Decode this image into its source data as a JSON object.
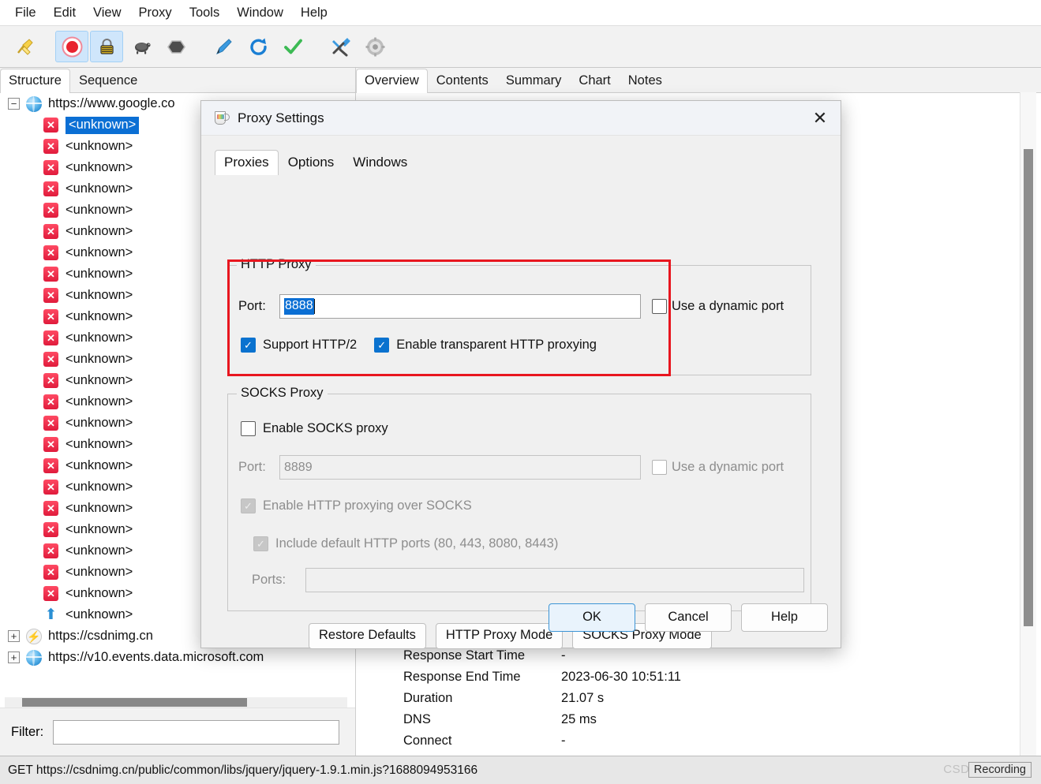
{
  "menubar": {
    "items": [
      "File",
      "Edit",
      "View",
      "Proxy",
      "Tools",
      "Window",
      "Help"
    ]
  },
  "toolbar": {
    "buttons": [
      {
        "name": "clear-session",
        "icon": "broom-icon",
        "glyph": "🧹",
        "active": false
      },
      {
        "name": "start-stop-recording",
        "icon": "record-icon",
        "glyph": "⏺",
        "active": true
      },
      {
        "name": "ssl-proxying",
        "icon": "lock-icon",
        "glyph": "🔒",
        "active": true
      },
      {
        "name": "throttling",
        "icon": "turtle-icon",
        "glyph": "🐢",
        "active": false
      },
      {
        "name": "breakpoints",
        "icon": "hexagon-icon",
        "glyph": "⬢",
        "active": false
      },
      {
        "name": "compose",
        "icon": "pen-icon",
        "glyph": "🖊",
        "active": false
      },
      {
        "name": "repeat",
        "icon": "refresh-icon",
        "glyph": "↻",
        "active": false
      },
      {
        "name": "validate",
        "icon": "checkmark-icon",
        "glyph": "✔",
        "active": false
      },
      {
        "name": "tools",
        "icon": "tools-icon",
        "glyph": "🛠",
        "active": false
      },
      {
        "name": "settings",
        "icon": "gear-icon",
        "glyph": "⚙",
        "active": false
      }
    ]
  },
  "left_tabs": {
    "items": [
      "Structure",
      "Sequence"
    ],
    "selected": "Structure"
  },
  "right_tabs": {
    "items": [
      "Overview",
      "Contents",
      "Summary",
      "Chart",
      "Notes"
    ],
    "selected": "Overview"
  },
  "tree": {
    "rows": [
      {
        "kind": "root",
        "icon": "globe-icon",
        "expander": "minus",
        "label": "https://www.google.co",
        "selected": false
      },
      {
        "kind": "child",
        "icon": "error-icon",
        "label": "<unknown>",
        "selected": true
      },
      {
        "kind": "child",
        "icon": "error-icon",
        "label": "<unknown>",
        "selected": false
      },
      {
        "kind": "child",
        "icon": "error-icon",
        "label": "<unknown>",
        "selected": false
      },
      {
        "kind": "child",
        "icon": "error-icon",
        "label": "<unknown>",
        "selected": false
      },
      {
        "kind": "child",
        "icon": "error-icon",
        "label": "<unknown>",
        "selected": false
      },
      {
        "kind": "child",
        "icon": "error-icon",
        "label": "<unknown>",
        "selected": false
      },
      {
        "kind": "child",
        "icon": "error-icon",
        "label": "<unknown>",
        "selected": false
      },
      {
        "kind": "child",
        "icon": "error-icon",
        "label": "<unknown>",
        "selected": false
      },
      {
        "kind": "child",
        "icon": "error-icon",
        "label": "<unknown>",
        "selected": false
      },
      {
        "kind": "child",
        "icon": "error-icon",
        "label": "<unknown>",
        "selected": false
      },
      {
        "kind": "child",
        "icon": "error-icon",
        "label": "<unknown>",
        "selected": false
      },
      {
        "kind": "child",
        "icon": "error-icon",
        "label": "<unknown>",
        "selected": false
      },
      {
        "kind": "child",
        "icon": "error-icon",
        "label": "<unknown>",
        "selected": false
      },
      {
        "kind": "child",
        "icon": "error-icon",
        "label": "<unknown>",
        "selected": false
      },
      {
        "kind": "child",
        "icon": "error-icon",
        "label": "<unknown>",
        "selected": false
      },
      {
        "kind": "child",
        "icon": "error-icon",
        "label": "<unknown>",
        "selected": false
      },
      {
        "kind": "child",
        "icon": "error-icon",
        "label": "<unknown>",
        "selected": false
      },
      {
        "kind": "child",
        "icon": "error-icon",
        "label": "<unknown>",
        "selected": false
      },
      {
        "kind": "child",
        "icon": "error-icon",
        "label": "<unknown>",
        "selected": false
      },
      {
        "kind": "child",
        "icon": "error-icon",
        "label": "<unknown>",
        "selected": false
      },
      {
        "kind": "child",
        "icon": "error-icon",
        "label": "<unknown>",
        "selected": false
      },
      {
        "kind": "child",
        "icon": "error-icon",
        "label": "<unknown>",
        "selected": false
      },
      {
        "kind": "child",
        "icon": "error-icon",
        "label": "<unknown>",
        "selected": false
      },
      {
        "kind": "child",
        "icon": "upload-icon",
        "label": "<unknown>",
        "selected": false
      },
      {
        "kind": "root",
        "icon": "bolt-icon",
        "expander": "plus",
        "label": "https://csdnimg.cn",
        "selected": false
      },
      {
        "kind": "root",
        "icon": "globe-icon",
        "expander": "plus",
        "label": "https://v10.events.data.microsoft.com",
        "selected": false
      }
    ]
  },
  "filter": {
    "label": "Filter:",
    "value": "",
    "placeholder": ""
  },
  "detail": {
    "rows": [
      {
        "key": "Response Start Time",
        "value": "-"
      },
      {
        "key": "Response End Time",
        "value": "2023-06-30 10:51:11"
      },
      {
        "key": "Duration",
        "value": "21.07 s"
      },
      {
        "key": "DNS",
        "value": "25 ms"
      },
      {
        "key": "Connect",
        "value": "-"
      }
    ]
  },
  "statusbar": {
    "text": "GET https://csdnimg.cn/public/common/libs/jquery/jquery-1.9.1.min.js?1688094953166",
    "watermark": "CSDN @To",
    "recording_label": "Recording"
  },
  "dialog": {
    "title": "Proxy Settings",
    "icon": "charles-cup-icon",
    "close_label": "✕",
    "tabs": {
      "items": [
        "Proxies",
        "Options",
        "Windows"
      ],
      "selected": "Proxies"
    },
    "http_proxy": {
      "legend": "HTTP Proxy",
      "port_label": "Port:",
      "port_value": "8888",
      "port_selected": true,
      "dynamic_port_label": "Use a dynamic port",
      "dynamic_port_checked": false,
      "support_http2_label": "Support HTTP/2",
      "support_http2_checked": true,
      "transparent_label": "Enable transparent HTTP proxying",
      "transparent_checked": true
    },
    "socks_proxy": {
      "legend": "SOCKS Proxy",
      "enable_label": "Enable SOCKS proxy",
      "enable_checked": false,
      "port_label": "Port:",
      "port_value": "8889",
      "dynamic_port_label": "Use a dynamic port",
      "dynamic_port_checked": false,
      "http_over_socks_label": "Enable HTTP proxying over SOCKS",
      "http_over_socks_checked": true,
      "default_ports_label": "Include default HTTP ports (80, 443, 8080, 8443)",
      "default_ports_checked": true,
      "ports_label": "Ports:",
      "ports_value": ""
    },
    "mode_buttons": [
      "Restore Defaults",
      "HTTP Proxy Mode",
      "SOCKS Proxy Mode"
    ],
    "footer_buttons": [
      "OK",
      "Cancel",
      "Help"
    ]
  },
  "colors": {
    "accent_blue": "#0a72cf",
    "selection_blue": "#0b6fd4",
    "highlight_red": "#e8161f",
    "error_red": "#e01b3c",
    "panel_gray": "#f0f0f0"
  }
}
